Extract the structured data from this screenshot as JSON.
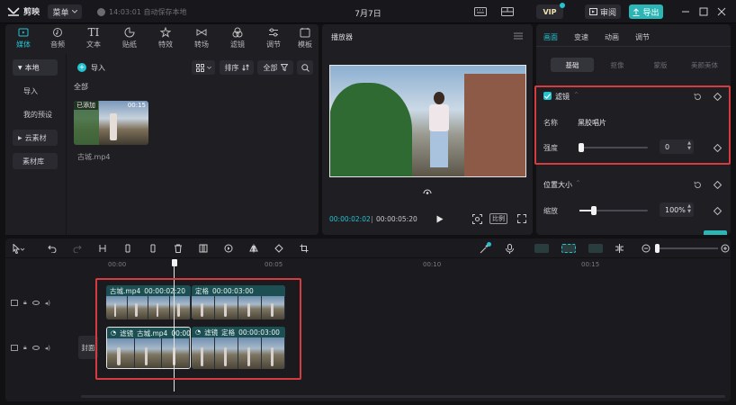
{
  "app": {
    "logo_text": "剪映",
    "menu_label": "菜单",
    "autosave": "14:03:01 自动保存本地",
    "project_title": "7月7日",
    "vip_label": "VIP",
    "review_label": "审阅",
    "export_label": "导出"
  },
  "media": {
    "tabs": [
      {
        "label": "媒体",
        "icon": "media-icon",
        "active": true
      },
      {
        "label": "音频",
        "icon": "audio-icon"
      },
      {
        "label": "文本",
        "icon": "text-icon"
      },
      {
        "label": "贴纸",
        "icon": "sticker-icon"
      },
      {
        "label": "特效",
        "icon": "effects-icon"
      },
      {
        "label": "转场",
        "icon": "transition-icon"
      },
      {
        "label": "滤镜",
        "icon": "filter-icon"
      },
      {
        "label": "调节",
        "icon": "adjust-icon"
      },
      {
        "label": "模板",
        "icon": "template-icon"
      }
    ],
    "sidebar": [
      "本地",
      "导入",
      "我的预设",
      "云素材",
      "素材库"
    ],
    "import_label": "导入",
    "sort_label": "排序",
    "all_label": "全部",
    "section_label": "全部",
    "clip": {
      "badge": "已添加",
      "duration": "00:15",
      "name": "古城.mp4"
    }
  },
  "player": {
    "title": "播放器",
    "current_time": "00:00:02:02",
    "total_time": "00:00:05:20",
    "ratio_label": "比例"
  },
  "props": {
    "tabs": [
      "画面",
      "变速",
      "动画",
      "调节"
    ],
    "subtabs": [
      "基础",
      "抠像",
      "蒙版",
      "美颜美体"
    ],
    "filter_section": {
      "title": "滤镜",
      "name_label": "名称",
      "name_value": "黑胶唱片",
      "strength_label": "强度",
      "strength_value": "0",
      "strength_level": 0
    },
    "position_section": {
      "title": "位置大小",
      "scale_label": "缩放",
      "scale_value": "100%",
      "scale_level": 1.0
    }
  },
  "timeline": {
    "ruler": [
      "00:00",
      "00:05",
      "00:10",
      "00:15"
    ],
    "cover_label": "封面",
    "top_track": [
      {
        "name": "古城.mp4",
        "time": "00:00:02:20"
      },
      {
        "name": "定格",
        "time": "00:00:03:00"
      }
    ],
    "main_track": [
      {
        "tag": "滤镜",
        "name": "古城.mp4",
        "time": "00:00:0"
      },
      {
        "tag": "滤镜",
        "name": "定格",
        "time": "00:00:03:00"
      }
    ]
  },
  "colors": {
    "accent": "#25c2d0",
    "highlight_box": "#d63b3f",
    "export_bg": "#2bb5b5"
  }
}
